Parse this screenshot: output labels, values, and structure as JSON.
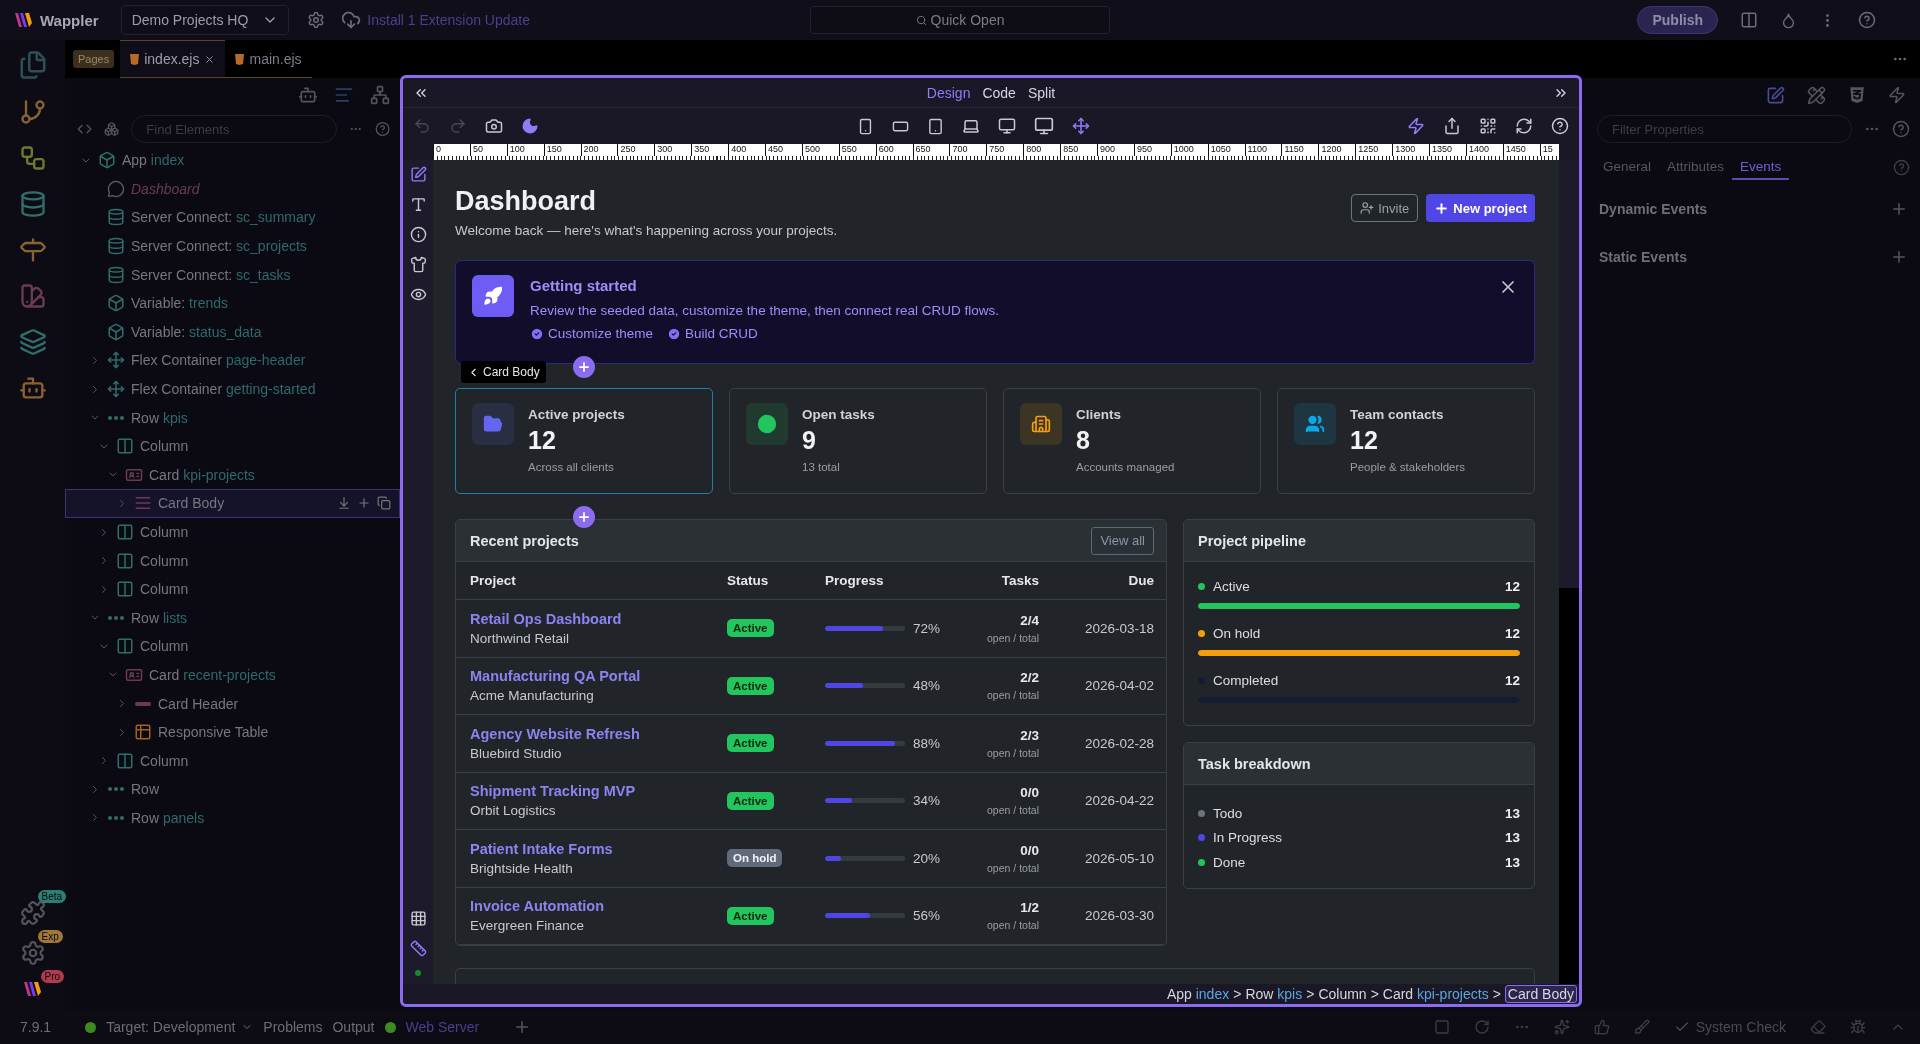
{
  "top_bar": {
    "app_name": "Wappler",
    "project": "Demo Projects HQ",
    "update_link": "Install 1 Extension Update",
    "quick_open": "Quick Open",
    "publish": "Publish"
  },
  "file_tabs": {
    "badge": "Pages",
    "tabs": [
      {
        "label": "index.ejs",
        "selected": true,
        "closable": true
      },
      {
        "label": "main.ejs",
        "selected": false,
        "closable": false
      }
    ]
  },
  "activity_badges": [
    "Beta",
    "Exp",
    "Pro"
  ],
  "structure": {
    "search_placeholder": "Find Elements",
    "tree": [
      {
        "kind": "app",
        "label": "App",
        "name": "index",
        "expanded": true,
        "selected": false,
        "children": [
          {
            "kind": "comment",
            "label": "Dashboard",
            "selected": false
          },
          {
            "kind": "server_connect",
            "label": "Server Connect:",
            "name": "sc_summary",
            "selected": false
          },
          {
            "kind": "server_connect",
            "label": "Server Connect:",
            "name": "sc_projects",
            "selected": false
          },
          {
            "kind": "server_connect",
            "label": "Server Connect:",
            "name": "sc_tasks",
            "selected": false
          },
          {
            "kind": "variable",
            "label": "Variable:",
            "name": "trends",
            "selected": false
          },
          {
            "kind": "variable",
            "label": "Variable:",
            "name": "status_data",
            "selected": false
          },
          {
            "kind": "flex",
            "label": "Flex Container",
            "name": "page-header",
            "expanded": false,
            "selected": false
          },
          {
            "kind": "flex",
            "label": "Flex Container",
            "name": "getting-started",
            "expanded": false,
            "selected": false
          },
          {
            "kind": "row",
            "label": "Row",
            "name": "kpis",
            "expanded": true,
            "selected": false,
            "children": [
              {
                "kind": "column",
                "label": "Column",
                "expanded": true,
                "selected": false,
                "children": [
                  {
                    "kind": "card",
                    "label": "Card",
                    "name": "kpi-projects",
                    "expanded": true,
                    "selected": false,
                    "children": [
                      {
                        "kind": "card_body",
                        "label": "Card Body",
                        "expanded": false,
                        "selected": true
                      }
                    ]
                  }
                ]
              },
              {
                "kind": "column",
                "label": "Column",
                "expanded": false,
                "selected": false
              },
              {
                "kind": "column",
                "label": "Column",
                "expanded": false,
                "selected": false
              },
              {
                "kind": "column",
                "label": "Column",
                "expanded": false,
                "selected": false
              }
            ]
          },
          {
            "kind": "row",
            "label": "Row",
            "name": "lists",
            "expanded": true,
            "selected": false,
            "children": [
              {
                "kind": "column",
                "label": "Column",
                "expanded": true,
                "selected": false,
                "children": [
                  {
                    "kind": "card",
                    "label": "Card",
                    "name": "recent-projects",
                    "expanded": true,
                    "selected": false,
                    "children": [
                      {
                        "kind": "card_header",
                        "label": "Card Header",
                        "expanded": false,
                        "selected": false
                      },
                      {
                        "kind": "table",
                        "label": "Responsive Table",
                        "expanded": false,
                        "selected": false
                      }
                    ]
                  }
                ]
              },
              {
                "kind": "column",
                "label": "Column",
                "expanded": false,
                "selected": false
              }
            ]
          },
          {
            "kind": "row",
            "label": "Row",
            "expanded": false,
            "selected": false
          },
          {
            "kind": "row",
            "label": "Row",
            "name": "panels",
            "expanded": false,
            "selected": false
          }
        ]
      }
    ]
  },
  "designer": {
    "view_tabs": [
      {
        "label": "Design",
        "selected": true
      },
      {
        "label": "Code",
        "selected": false
      },
      {
        "label": "Split",
        "selected": false
      }
    ],
    "ruler_labels": [
      "0",
      "50",
      "100",
      "150",
      "200",
      "250",
      "300",
      "350",
      "400",
      "450",
      "500",
      "550",
      "600",
      "650",
      "700",
      "750",
      "800",
      "850",
      "900",
      "950",
      "1000",
      "1050",
      "1100",
      "1150",
      "1200",
      "1250",
      "1300",
      "1350",
      "1400",
      "1450",
      "15"
    ],
    "page": {
      "title": "Dashboard",
      "subtitle": "Welcome back — here's what's happening across your projects.",
      "invite": "Invite",
      "new_project": "New project",
      "alert": {
        "title": "Getting started",
        "text": "Review the seeded data, customize the theme, then connect real CRUD flows.",
        "checks": [
          "Customize theme",
          "Build CRUD"
        ]
      },
      "selection_tag": "Card Body",
      "kpis": [
        {
          "kind": "projects",
          "title": "Active projects",
          "value": "12",
          "note": "Across all clients",
          "color": "#6366f1",
          "selected": true
        },
        {
          "kind": "tasks",
          "title": "Open tasks",
          "value": "9",
          "note": "13 total",
          "color": "#22c55e",
          "selected": false
        },
        {
          "kind": "clients",
          "title": "Clients",
          "value": "8",
          "note": "Accounts managed",
          "color": "#f59e0b",
          "selected": false
        },
        {
          "kind": "contacts",
          "title": "Team contacts",
          "value": "12",
          "note": "People & stakeholders",
          "color": "#0ea5e9",
          "selected": false
        }
      ],
      "recent_projects": {
        "title": "Recent projects",
        "view_all": "View all",
        "columns": [
          "Project",
          "Status",
          "Progress",
          "Tasks",
          "Due"
        ],
        "rows": [
          {
            "name": "Retail Ops Dashboard",
            "client": "Northwind Retail",
            "status": {
              "kind": "active",
              "label": "Active"
            },
            "level": 0.72,
            "percent": "72%",
            "tasks": "2/4",
            "tasks_note": "open / total",
            "due": "2026-03-18"
          },
          {
            "name": "Manufacturing QA Portal",
            "client": "Acme Manufacturing",
            "status": {
              "kind": "active",
              "label": "Active"
            },
            "level": 0.48,
            "percent": "48%",
            "tasks": "2/2",
            "tasks_note": "open / total",
            "due": "2026-04-02"
          },
          {
            "name": "Agency Website Refresh",
            "client": "Bluebird Studio",
            "status": {
              "kind": "active",
              "label": "Active"
            },
            "level": 0.88,
            "percent": "88%",
            "tasks": "2/3",
            "tasks_note": "open / total",
            "due": "2026-02-28"
          },
          {
            "name": "Shipment Tracking MVP",
            "client": "Orbit Logistics",
            "status": {
              "kind": "active",
              "label": "Active"
            },
            "level": 0.34,
            "percent": "34%",
            "tasks": "0/0",
            "tasks_note": "open / total",
            "due": "2026-04-22"
          },
          {
            "name": "Patient Intake Forms",
            "client": "Brightside Health",
            "status": {
              "kind": "on_hold",
              "label": "On hold"
            },
            "level": 0.2,
            "percent": "20%",
            "tasks": "0/0",
            "tasks_note": "open / total",
            "due": "2026-05-10"
          },
          {
            "name": "Invoice Automation",
            "client": "Evergreen Finance",
            "status": {
              "kind": "active",
              "label": "Active"
            },
            "level": 0.56,
            "percent": "56%",
            "tasks": "1/2",
            "tasks_note": "open / total",
            "due": "2026-03-30"
          }
        ]
      },
      "pipeline": {
        "title": "Project pipeline",
        "items": [
          {
            "label": "Active",
            "value": "12",
            "color": "#22c55e",
            "level": 1
          },
          {
            "label": "On hold",
            "value": "12",
            "color": "#f59e0b",
            "level": 1
          },
          {
            "label": "Completed",
            "value": "12",
            "color": "#141b33",
            "level": 1
          }
        ]
      },
      "task_breakdown": {
        "title": "Task breakdown",
        "items": [
          {
            "label": "Todo",
            "value": "13",
            "color": "#6b7280"
          },
          {
            "label": "In Progress",
            "value": "13",
            "color": "#4f46e5"
          },
          {
            "label": "Done",
            "value": "13",
            "color": "#22c55e"
          }
        ]
      }
    },
    "breadcrumb": [
      {
        "label": "App",
        "name": "index",
        "selected": false
      },
      {
        "separator": ">",
        "label": "Row",
        "name": "kpis",
        "selected": false
      },
      {
        "separator": ">",
        "label": "Column",
        "selected": false
      },
      {
        "separator": ">",
        "label": "Card",
        "name": "kpi-projects",
        "selected": false
      },
      {
        "separator": ">",
        "label": "Card Body",
        "selected": true
      }
    ]
  },
  "properties": {
    "filter_placeholder": "Filter Properties",
    "tabs": [
      {
        "label": "General",
        "selected": false
      },
      {
        "label": "Attributes",
        "selected": false
      },
      {
        "label": "Events",
        "selected": true
      }
    ],
    "sections": [
      "Dynamic Events",
      "Static Events"
    ]
  },
  "status_bar": {
    "version": "7.9.1",
    "target_label": "Target:",
    "target": "Development",
    "problems": "Problems",
    "output": "Output",
    "web_server": "Web Server",
    "system_check": "System Check"
  }
}
